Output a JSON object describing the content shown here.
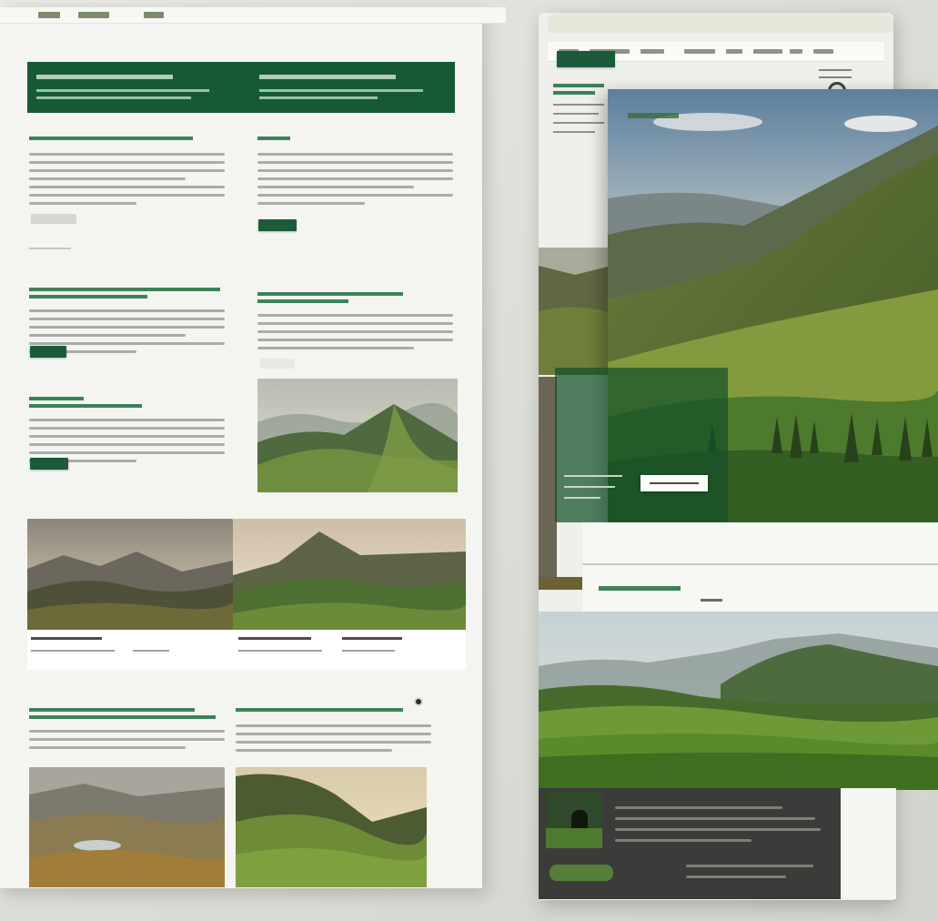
{
  "window": {
    "title": ""
  },
  "left_page": {
    "hero": {
      "title_left": "",
      "subtitle_left": "",
      "title_right": "",
      "subtitle_right": ""
    },
    "section_a": {
      "heading_left": "",
      "heading_right": ""
    },
    "section_b": {
      "heading_left": "",
      "heading_right": ""
    },
    "section_c": {
      "heading_left": ""
    },
    "gallery_captions": [
      {
        "title": "",
        "sub": ""
      },
      {
        "title": "",
        "sub": ""
      },
      {
        "title": "",
        "sub": ""
      }
    ],
    "section_d": {
      "heading_left": "",
      "heading_right": ""
    }
  },
  "right_page": {
    "nav_items": [
      "",
      "",
      "",
      "",
      "",
      "",
      "",
      ""
    ],
    "sidebar_heading": "",
    "photo_label": "",
    "band_heading": "",
    "footer_heading": ""
  },
  "colors": {
    "brand_green": "#155a35",
    "accent_green": "#1f6d3f",
    "page_bg": "#f4f4f0",
    "footer_dark": "#3b3c3a"
  },
  "icons": [
    "mountain-photo",
    "menu-icon",
    "avatar-icon"
  ]
}
